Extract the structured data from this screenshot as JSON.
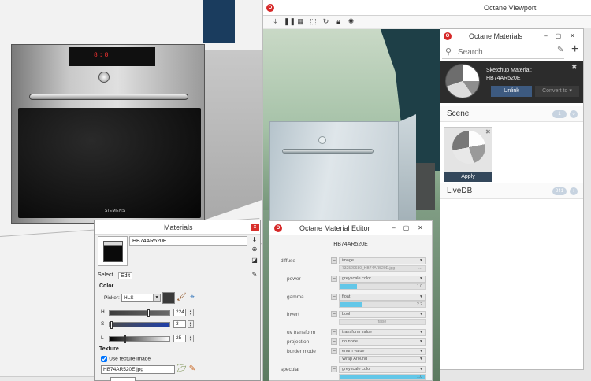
{
  "octane_viewport": {
    "title": "Octane Viewport",
    "logo": "octane-logo",
    "toolbar": [
      "export-icon",
      "pause-icon",
      "stop-icon",
      "region-icon",
      "refresh-icon",
      "lock-icon",
      "settings-icon"
    ]
  },
  "octane_materials": {
    "title": "Octane Materials",
    "search_placeholder": "Search",
    "selected": {
      "line1": "Sketchup Material:",
      "line2": "HB74AR520E",
      "unlink_label": "Unlink",
      "convert_label": "Convert to"
    },
    "scene": {
      "label": "Scene",
      "count": "1"
    },
    "tile": {
      "apply_label": "Apply"
    },
    "livedb": {
      "label": "LiveDB",
      "count": "241"
    }
  },
  "material_editor": {
    "title": "Octane Material Editor",
    "material_name": "HB74AR520E",
    "diffuse": {
      "label": "diffuse",
      "value": "image",
      "file": "732520680_HB74AR520E.jpg"
    },
    "power": {
      "label": "power",
      "value": "greyscale color",
      "level": 1.0,
      "level_text": "1.0"
    },
    "gamma": {
      "label": "gamma",
      "value": "float",
      "level": 2.2,
      "level_text": "2.2",
      "max": 8
    },
    "invert": {
      "label": "invert",
      "value": "bool",
      "state": "false"
    },
    "uv_transform": {
      "label": "uv transform",
      "value": "transform value"
    },
    "projection": {
      "label": "projection",
      "value": "no node"
    },
    "border_mode": {
      "label": "border mode",
      "value": "enum value",
      "option": "Wrap Around"
    },
    "specular": {
      "label": "specular",
      "value": "greyscale color",
      "level": 1.0,
      "level_text": "1.0"
    }
  },
  "materials_dialog": {
    "title": "Materials",
    "close_glyph": "x",
    "material_name": "HB74AR520E",
    "tab_select": "Select",
    "tab_edit": "Edit",
    "color_heading": "Color",
    "picker_label": "Picker:",
    "picker_value": "HLS",
    "h_label": "H",
    "h_value": "224",
    "s_label": "S",
    "s_value": "3",
    "l_label": "L",
    "l_value": "25",
    "texture_heading": "Texture",
    "use_texture_label": "Use texture image",
    "use_texture": true,
    "texture_file": "HB74AR520E.jpg"
  },
  "oven": {
    "display": "8:8",
    "brand": "SIEMENS"
  }
}
